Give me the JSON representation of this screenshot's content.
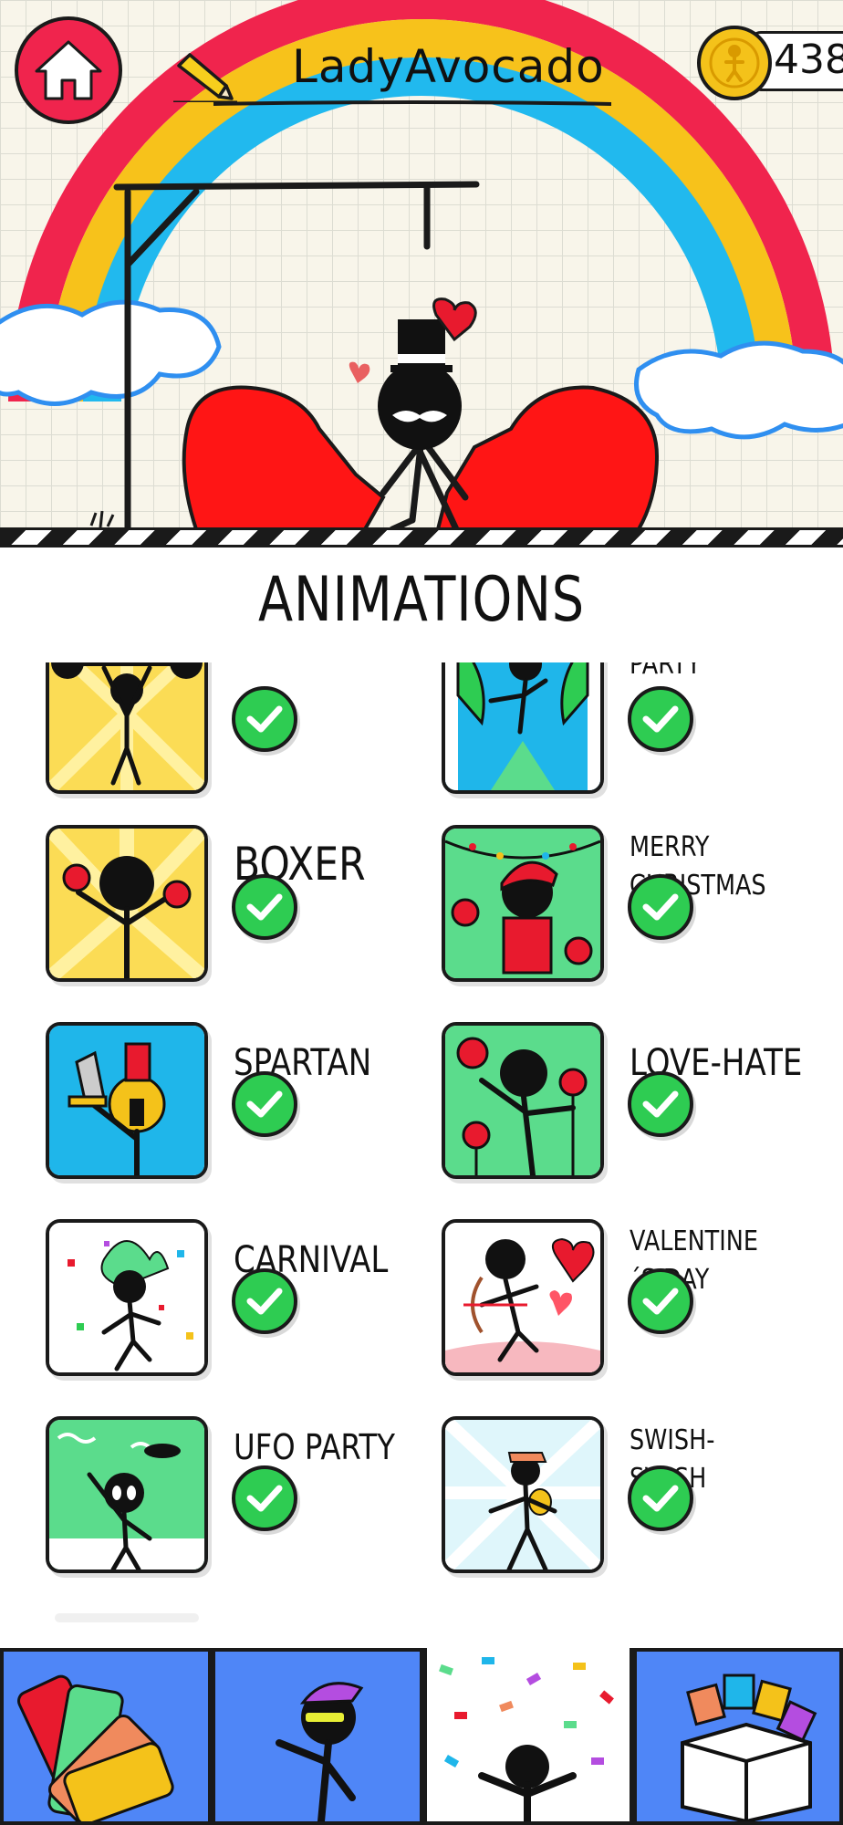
{
  "header": {
    "username": "LadyAvocado",
    "coins": "438"
  },
  "section": {
    "title": "ANIMATIONS"
  },
  "animations": [
    {
      "name": "",
      "unlocked": true
    },
    {
      "name": "PARTY",
      "unlocked": true
    },
    {
      "name": "BOXER",
      "unlocked": true
    },
    {
      "name": "MERRY CHRISTMAS",
      "unlocked": true
    },
    {
      "name": "SPARTAN",
      "unlocked": true
    },
    {
      "name": "LOVE-HATE",
      "unlocked": true
    },
    {
      "name": "CARNIVAL",
      "unlocked": true
    },
    {
      "name": "VALENTINE´S DAY",
      "unlocked": true
    },
    {
      "name": "UFO PARTY",
      "unlocked": true
    },
    {
      "name": "SWISH-SWISH",
      "unlocked": true
    }
  ],
  "bottom_nav": {
    "tabs": [
      {
        "icon": "color-palette-icon",
        "selected": false
      },
      {
        "icon": "stickman-character-icon",
        "selected": false
      },
      {
        "icon": "confetti-animation-icon",
        "selected": true
      },
      {
        "icon": "words-box-icon",
        "selected": false
      }
    ]
  },
  "colors": {
    "accent_red": "#f0244d",
    "check_green": "#2ecc52",
    "nav_blue": "#4f86f7",
    "coin_gold": "#f4c21a"
  }
}
